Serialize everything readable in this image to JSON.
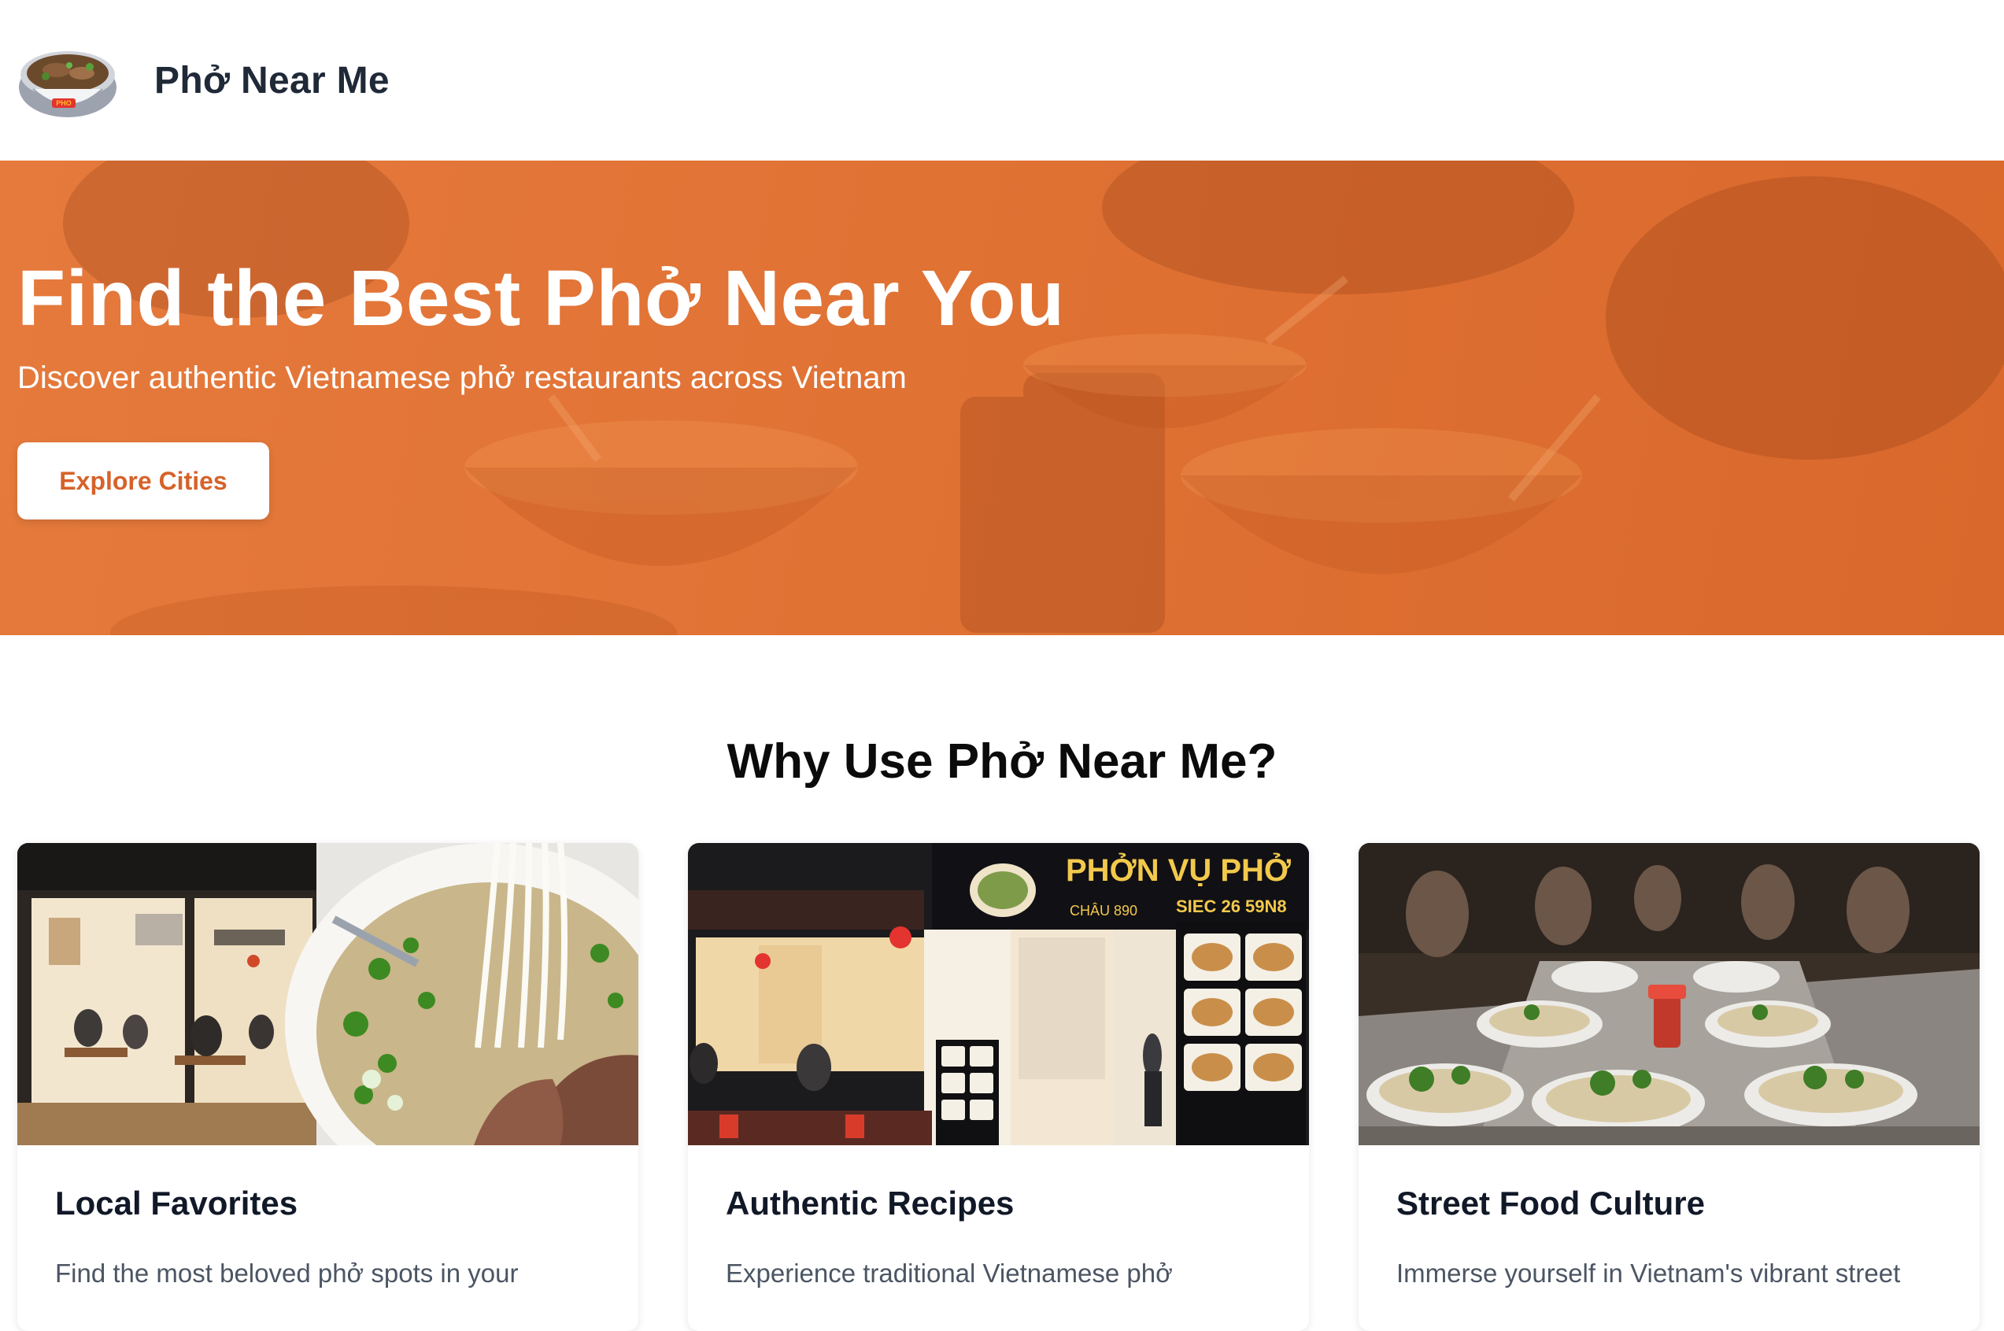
{
  "header": {
    "logo_text": "PHO",
    "title": "Phở Near Me"
  },
  "hero": {
    "title": "Find the Best Phở Near You",
    "subtitle": "Discover authentic Vietnamese phở restaurants across Vietnam",
    "cta_label": "Explore Cities"
  },
  "features": {
    "heading": "Why Use Phở Near Me?",
    "cards": [
      {
        "title": "Local Favorites",
        "text": "Find the most beloved phở spots in your"
      },
      {
        "title": "Authentic Recipes",
        "text": "Experience traditional Vietnamese phở",
        "sign_text": "PHỞN VỤ PHỞ",
        "sign_sub": "SIEC 26 59N8",
        "sign_sub2": "CHÂU 890"
      },
      {
        "title": "Street Food Culture",
        "text": "Immerse yourself in Vietnam's vibrant street"
      }
    ]
  },
  "colors": {
    "accent": "#e07234",
    "cta_text": "#d6622a",
    "heading": "#111827",
    "body_text": "#4b5563"
  }
}
